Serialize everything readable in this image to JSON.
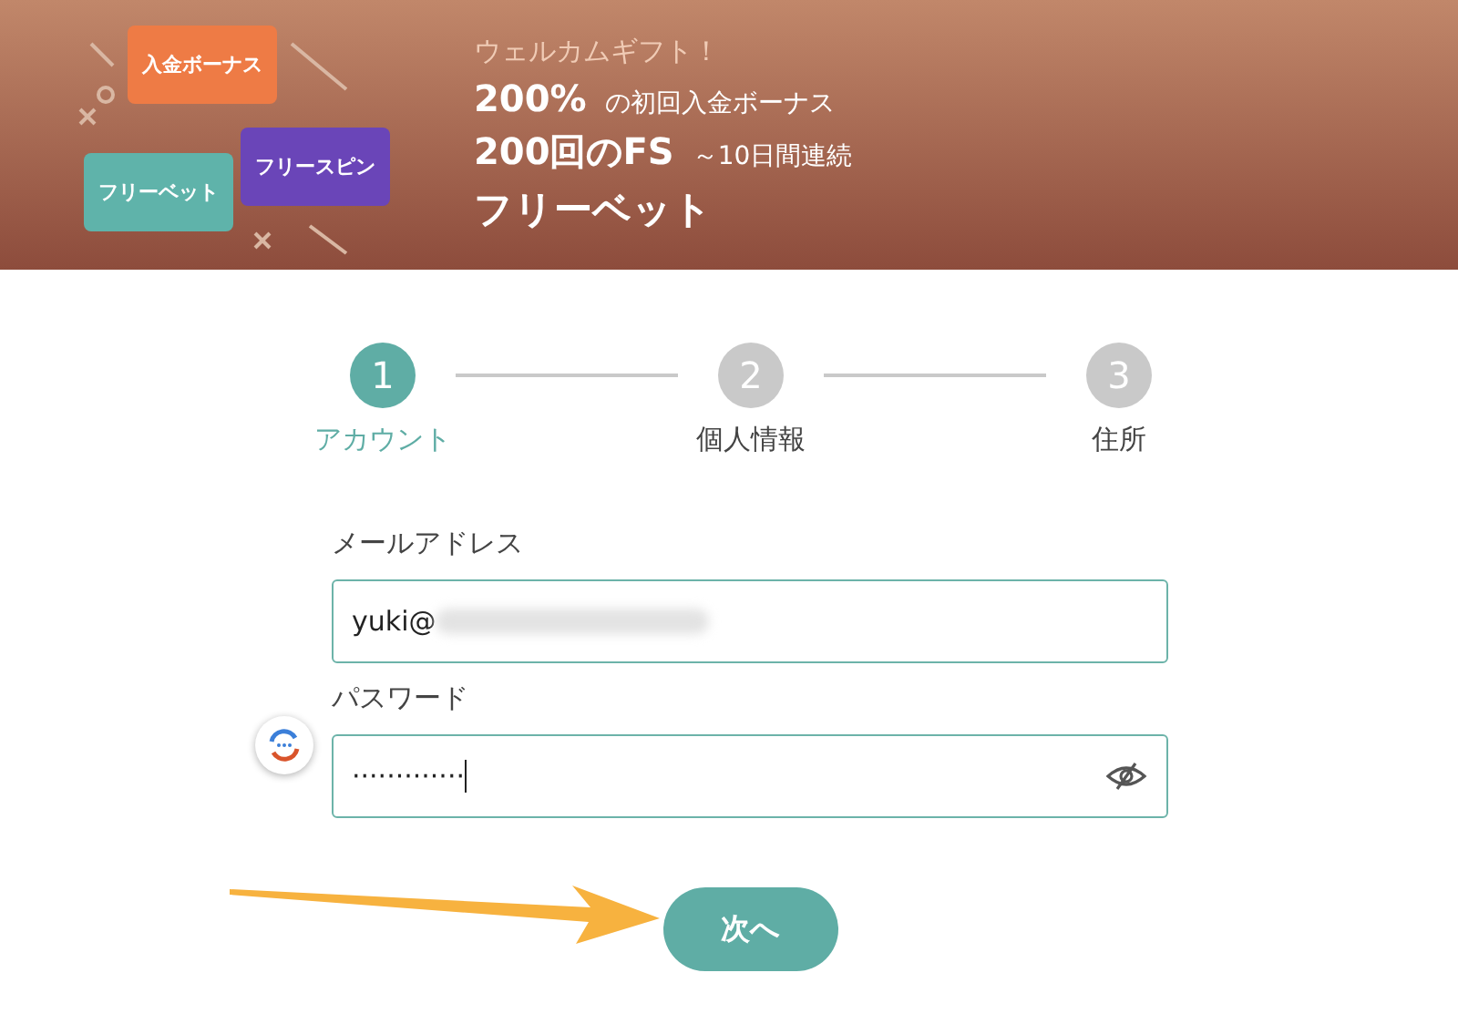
{
  "banner": {
    "tiles": [
      {
        "label": "入金ボーナス",
        "color": "#ee7b45"
      },
      {
        "label": "フリーベット",
        "color": "#5fb3aa"
      },
      {
        "label": "フリースピン",
        "color": "#6a45b8"
      }
    ],
    "heading": "ウェルカムギフト！",
    "offers": [
      {
        "highlight": "200%",
        "text": "の初回入金ボーナス"
      },
      {
        "highlight": "200回のFS",
        "text": "～10日間連続"
      }
    ],
    "footer": "フリーベット"
  },
  "steps": [
    {
      "number": "1",
      "label": "アカウント",
      "selected": true
    },
    {
      "number": "2",
      "label": "個人情報",
      "selected": false
    },
    {
      "number": "3",
      "label": "住所",
      "selected": false
    }
  ],
  "fields": [
    {
      "label": "メールアドレス",
      "value": "yuki@",
      "kind": "email"
    },
    {
      "label": "パスワード",
      "value": "·············",
      "kind": "password"
    }
  ],
  "next_button": "次へ"
}
